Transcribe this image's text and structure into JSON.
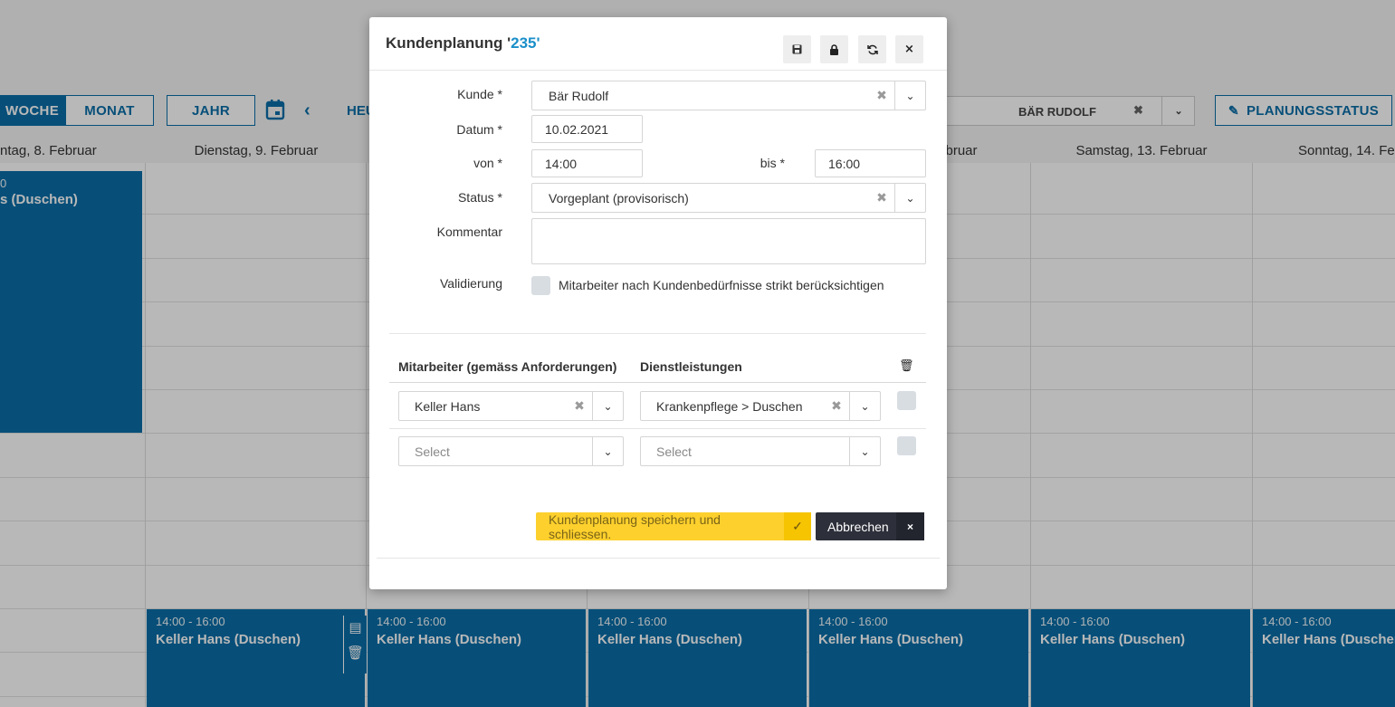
{
  "calendar": {
    "views": {
      "week": "WOCHE",
      "month": "MONAT",
      "year": "JAHR"
    },
    "today_label": "HEU",
    "customer_filter": "BÄR RUDOLF",
    "planning_status": "PLANUNGSSTATUS",
    "days": [
      "ntag, 8. Februar",
      "Dienstag, 9. Februar",
      "bruar",
      "Samstag, 13. Februar",
      "Sonntag, 14. Fe"
    ],
    "top_event": {
      "time": "0",
      "name": "s (Duschen)"
    },
    "events": [
      {
        "time": "14:00 - 16:00",
        "name": "Keller Hans (Duschen)"
      },
      {
        "time": "14:00 - 16:00",
        "name": "Keller Hans (Duschen)"
      },
      {
        "time": "14:00 - 16:00",
        "name": "Keller Hans (Duschen)"
      },
      {
        "time": "14:00 - 16:00",
        "name": "Keller Hans (Duschen)"
      },
      {
        "time": "14:00 - 16:00",
        "name": "Keller Hans (Duschen)"
      },
      {
        "time": "14:00 - 16:00",
        "name": "Keller Hans (Duschen"
      }
    ],
    "accent_color": "#0a6ea8"
  },
  "modal": {
    "title_prefix": "Kundenplanung '",
    "title_number": "235",
    "title_suffix": "'",
    "labels": {
      "customer": "Kunde *",
      "date": "Datum *",
      "from": "von *",
      "to": "bis *",
      "status": "Status *",
      "comment": "Kommentar",
      "validation": "Validierung"
    },
    "values": {
      "customer": "Bär Rudolf",
      "date": "10.02.2021",
      "from": "14:00",
      "to": "16:00",
      "status": "Vorgeplant (provisorisch)",
      "comment": ""
    },
    "validation_text": "Mitarbeiter nach Kundenbedürfnisse strikt berücksichtigen",
    "table": {
      "col_employee": "Mitarbeiter (gemäss Anforderungen)",
      "col_service": "Dienstleistungen",
      "rows": [
        {
          "employee": "Keller Hans",
          "service": "Krankenpflege > Duschen"
        },
        {
          "employee": "Select",
          "service": "Select"
        }
      ]
    },
    "buttons": {
      "save": "Kundenplanung speichern und schliessen.",
      "cancel": "Abbrechen"
    },
    "colors": {
      "save": "#fdd02d",
      "cancel": "#2d2f3a",
      "title_number": "#1a8fc9"
    }
  }
}
